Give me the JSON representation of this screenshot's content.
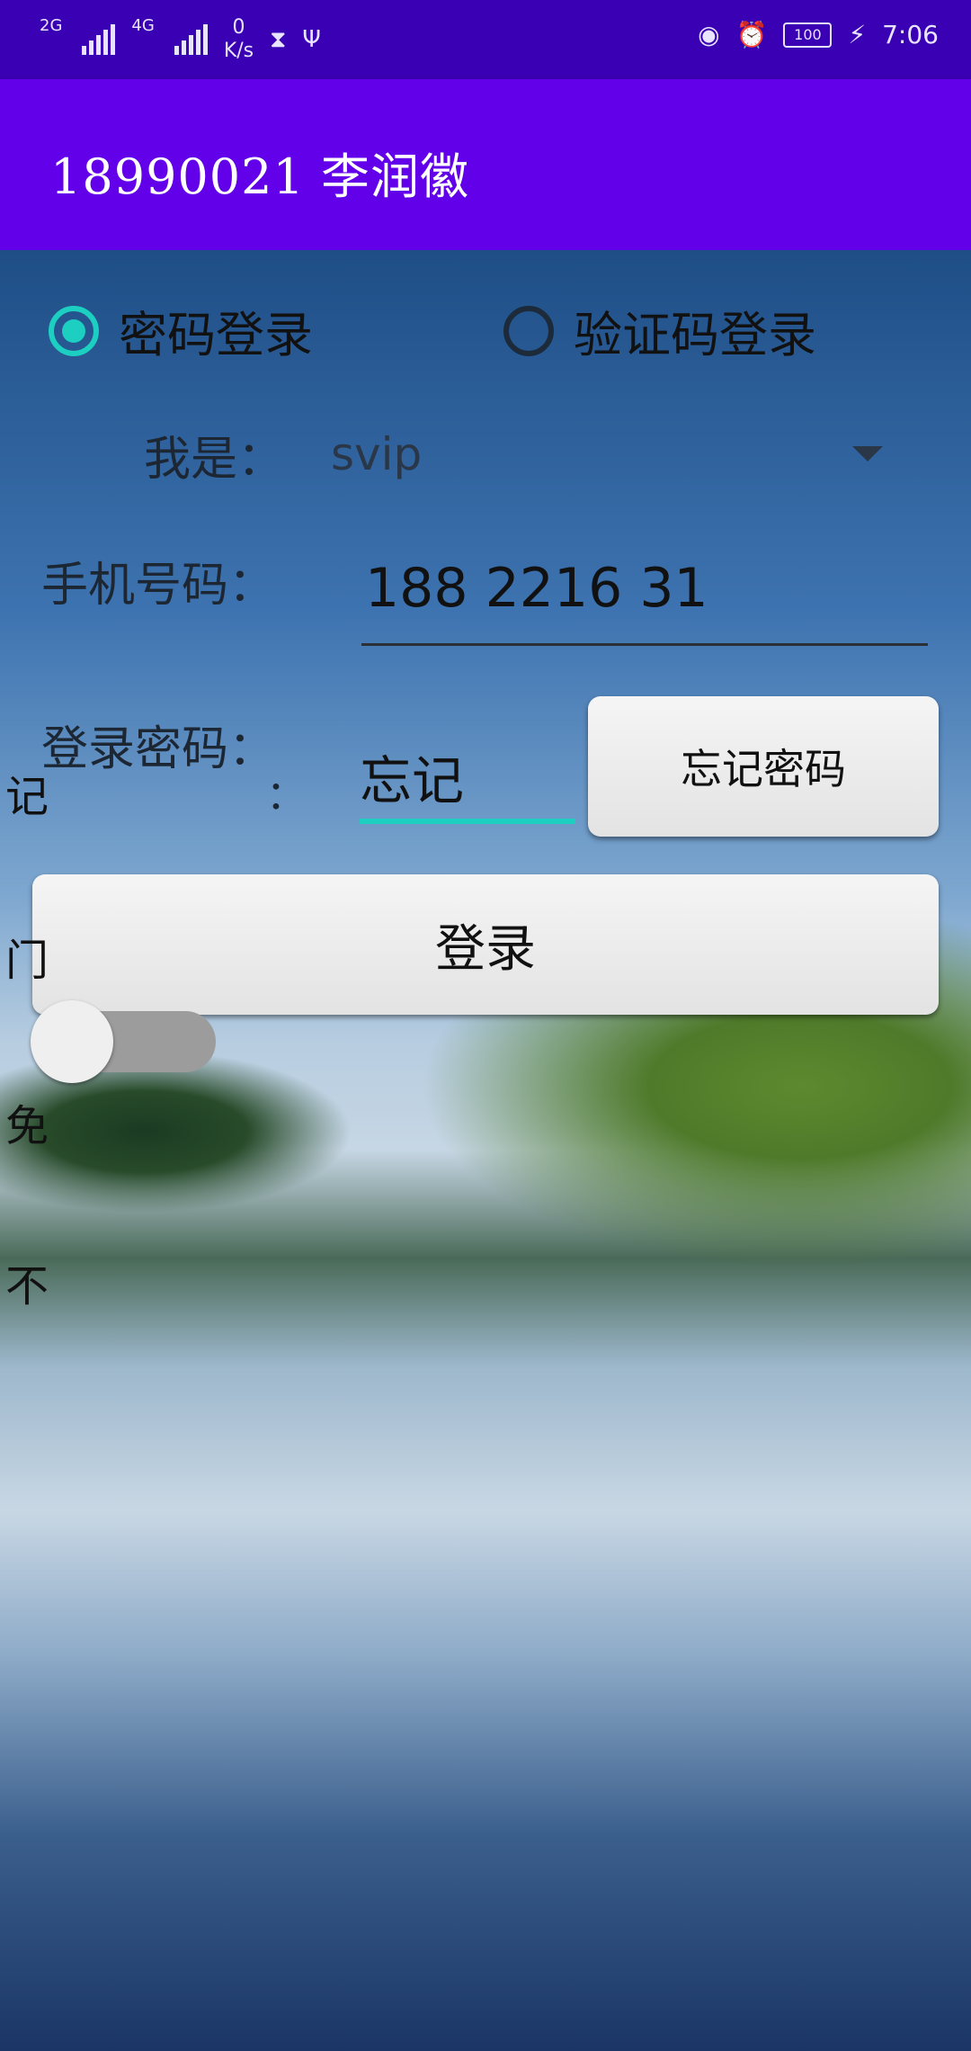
{
  "status_bar": {
    "network1": "2G",
    "network2": "4G",
    "speed_value": "0",
    "speed_unit": "K/s",
    "battery": "100",
    "time": "7:06"
  },
  "app_bar": {
    "title": "18990021 李润徽"
  },
  "login_mode": {
    "password_login": "密码登录",
    "sms_login": "验证码登录",
    "selected": "password_login"
  },
  "role": {
    "label": "我是：",
    "value": "svip"
  },
  "phone": {
    "label": "手机号码：",
    "value": "188 2216 31"
  },
  "password": {
    "label": "登录密码：",
    "value": "忘记"
  },
  "forgot_button": "忘记密码",
  "login_button": "登录",
  "overlap_fragments": {
    "colon": "：",
    "f1": "记",
    "f2": "门",
    "f3": "免",
    "f4": "不"
  },
  "remember_switch": {
    "on": false
  }
}
